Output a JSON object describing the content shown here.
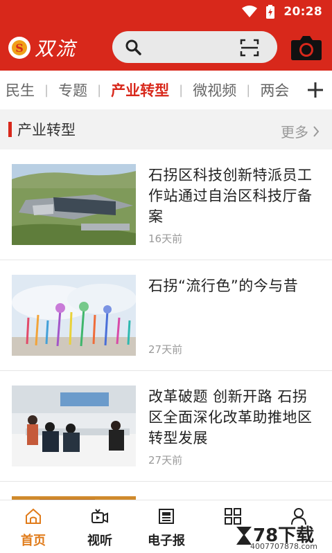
{
  "status": {
    "time": "20:28"
  },
  "header": {
    "logo_text": "双流",
    "logo_badge": "S"
  },
  "tabs": [
    {
      "label": "民生",
      "active": false
    },
    {
      "label": "专题",
      "active": false
    },
    {
      "label": "产业转型",
      "active": true
    },
    {
      "label": "微视频",
      "active": false
    },
    {
      "label": "两会",
      "active": false
    }
  ],
  "section": {
    "title": "产业转型",
    "more": "更多"
  },
  "articles": [
    {
      "title": "石拐区科技创新特派员工作站通过自治区科技厅备案",
      "time": "16天前"
    },
    {
      "title": "石拐“流行色”的今与昔",
      "time": "27天前"
    },
    {
      "title": "改革破题 创新开路 石拐区全面深化改革助推地区转型发展",
      "time": "27天前"
    }
  ],
  "bottom_nav": [
    {
      "label": "首页",
      "active": true
    },
    {
      "label": "视听",
      "active": false
    },
    {
      "label": "电子报",
      "active": false
    },
    {
      "label": "",
      "active": false
    },
    {
      "label": "",
      "active": false
    }
  ],
  "watermark": {
    "big": "78下载",
    "small": "4007707878.com"
  },
  "colors": {
    "brand_red": "#d8281b",
    "active_orange": "#e07b1a"
  }
}
